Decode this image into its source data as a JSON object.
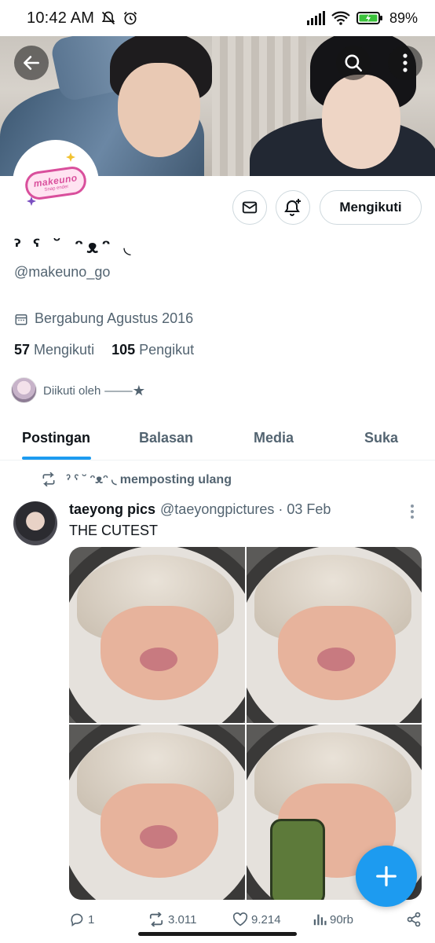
{
  "status_bar": {
    "time": "10:42 AM",
    "battery": "89%",
    "icons": [
      "bell-off-icon",
      "alarm-icon",
      "signal-icon",
      "wifi-icon",
      "battery-charging-icon"
    ]
  },
  "profile": {
    "display_name": "ˀ ˁ ˘ ᵔᴥᵔ ◟",
    "handle": "@makeuno_go",
    "avatar_logo": "makeuno",
    "avatar_logo_sub": "Snap ender",
    "joined": "Bergabung Agustus 2016",
    "following_count": "57",
    "following_label": "Mengikuti",
    "followers_count": "105",
    "followers_label": "Pengikut",
    "followed_by": "Diikuti oleh ⸻★"
  },
  "actions": {
    "follow_button": "Mengikuti"
  },
  "tabs": [
    {
      "label": "Postingan",
      "active": true
    },
    {
      "label": "Balasan",
      "active": false
    },
    {
      "label": "Media",
      "active": false
    },
    {
      "label": "Suka",
      "active": false
    }
  ],
  "post": {
    "repost_text": "ˀ ˁ ˘ ᵔᴥᵔ ◟ memposting ulang",
    "author_name": "taeyong pics",
    "author_handle": "@taeyongpictures · 03 Feb",
    "text": "THE CUTEST",
    "replies": "1",
    "reposts": "3.011",
    "likes": "9.214",
    "views": "90rb"
  },
  "colors": {
    "accent": "#1d9bf0",
    "text_primary": "#0f1419",
    "text_secondary": "#536471",
    "border": "#cfd9de"
  }
}
